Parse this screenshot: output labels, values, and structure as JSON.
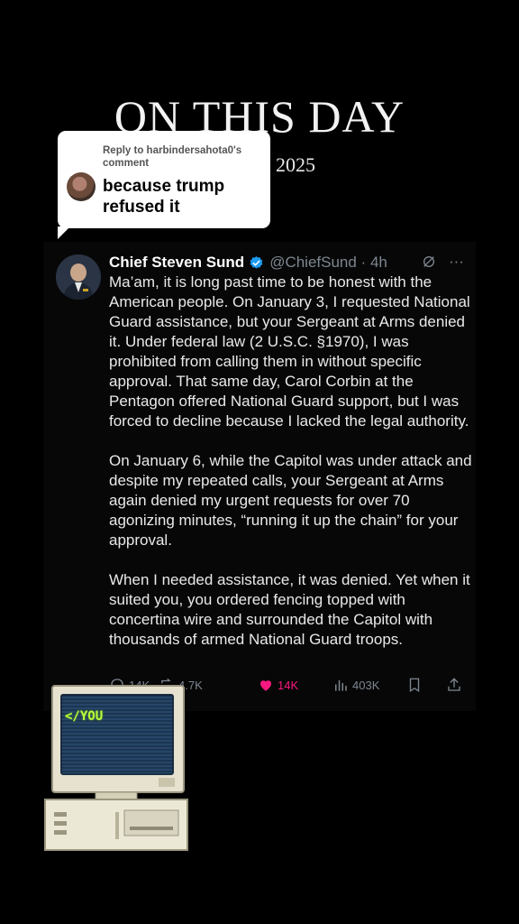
{
  "header": {
    "headline": "ON THIS DAY",
    "year": "2025"
  },
  "reply": {
    "label": "Reply to harbindersahota0's comment",
    "text": "because trump refused it"
  },
  "tweet": {
    "display_name": "Chief Steven Sund",
    "handle": "@ChiefSund · 4h",
    "paragraphs": [
      "Ma’am, it is long past time to be honest with the American people. On January 3, I requested National Guard assistance, but your Sergeant at Arms denied it. Under federal law (2 U.S.C. §1970), I was prohibited from calling them in without specific approval. That same day, Carol Corbin at the Pentagon offered National Guard support, but I was forced to decline because I lacked the legal authority.",
      "On January 6, while the Capitol was under attack and despite my repeated calls, your Sergeant at Arms again denied my urgent requests for over 70 agonizing minutes, “running it up the chain” for your approval.",
      "When I needed assistance, it was denied. Yet when it suited you, you ordered fencing topped with concertina wire and surrounded the Capitol with thousands of armed National Guard troops."
    ],
    "more_icon": "···",
    "stats": {
      "replies": "14K",
      "reposts": "4.7K",
      "likes": "14K",
      "views": "403K"
    },
    "colors": {
      "like": "#f91880",
      "verified": "#1d9bf0",
      "muted": "#7d8690"
    }
  },
  "sticker": {
    "screen_text": "</YOU"
  }
}
